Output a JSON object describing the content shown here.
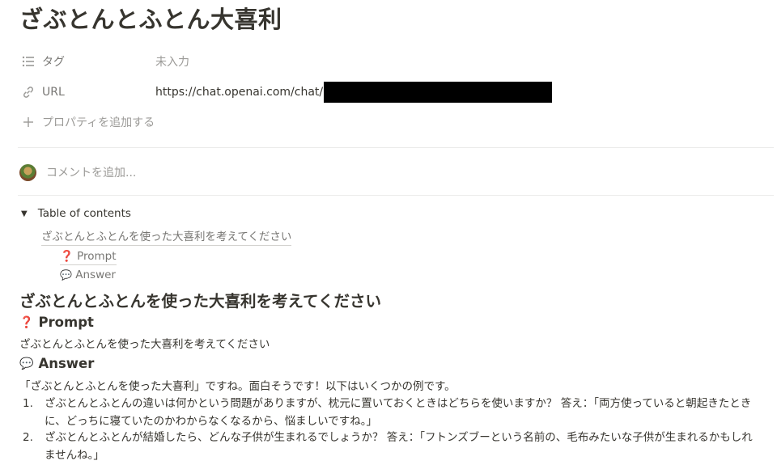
{
  "page": {
    "title": "ざぶとんとふとん大喜利"
  },
  "properties": [
    {
      "icon": "list-icon",
      "name": "タグ",
      "value": "未入力"
    },
    {
      "icon": "link-icon",
      "name": "URL",
      "value": "https://chat.openai.com/chat/"
    }
  ],
  "add_property": {
    "icon": "plus-icon",
    "label": "プロパティを追加する"
  },
  "comment": {
    "placeholder": "コメントを追加..."
  },
  "toc": {
    "header": "Table of contents",
    "items": [
      {
        "label": "ざぶとんとふとんを使った大喜利を考えてください"
      },
      {
        "emoji": "❓",
        "label": "Prompt"
      },
      {
        "emoji": "💬",
        "label": "Answer"
      }
    ]
  },
  "content": {
    "heading": "ざぶとんとふとんを使った大喜利を考えてください",
    "prompt": {
      "emoji": "❓",
      "title": "Prompt",
      "text": "ざぶとんとふとんを使った大喜利を考えてください"
    },
    "answer": {
      "emoji": "💬",
      "title": "Answer",
      "intro": "「ざぶとんとふとんを使った大喜利」ですね。面白そうです！以下はいくつかの例です。",
      "items": [
        {
          "num": "1.",
          "text": "ざぶとんとふとんの違いは何かという問題がありますが、枕元に置いておくときはどちらを使いますか？ 答え：「両方使っていると朝起きたときに、どっちに寝ていたのかわからなくなるから、悩ましいですね。」"
        },
        {
          "num": "2.",
          "text": "ざぶとんとふとんが結婚したら、どんな子供が生まれるでしょうか？ 答え：「フトンズブーという名前の、毛布みたいな子供が生まれるかもしれませんね。」"
        }
      ]
    }
  }
}
